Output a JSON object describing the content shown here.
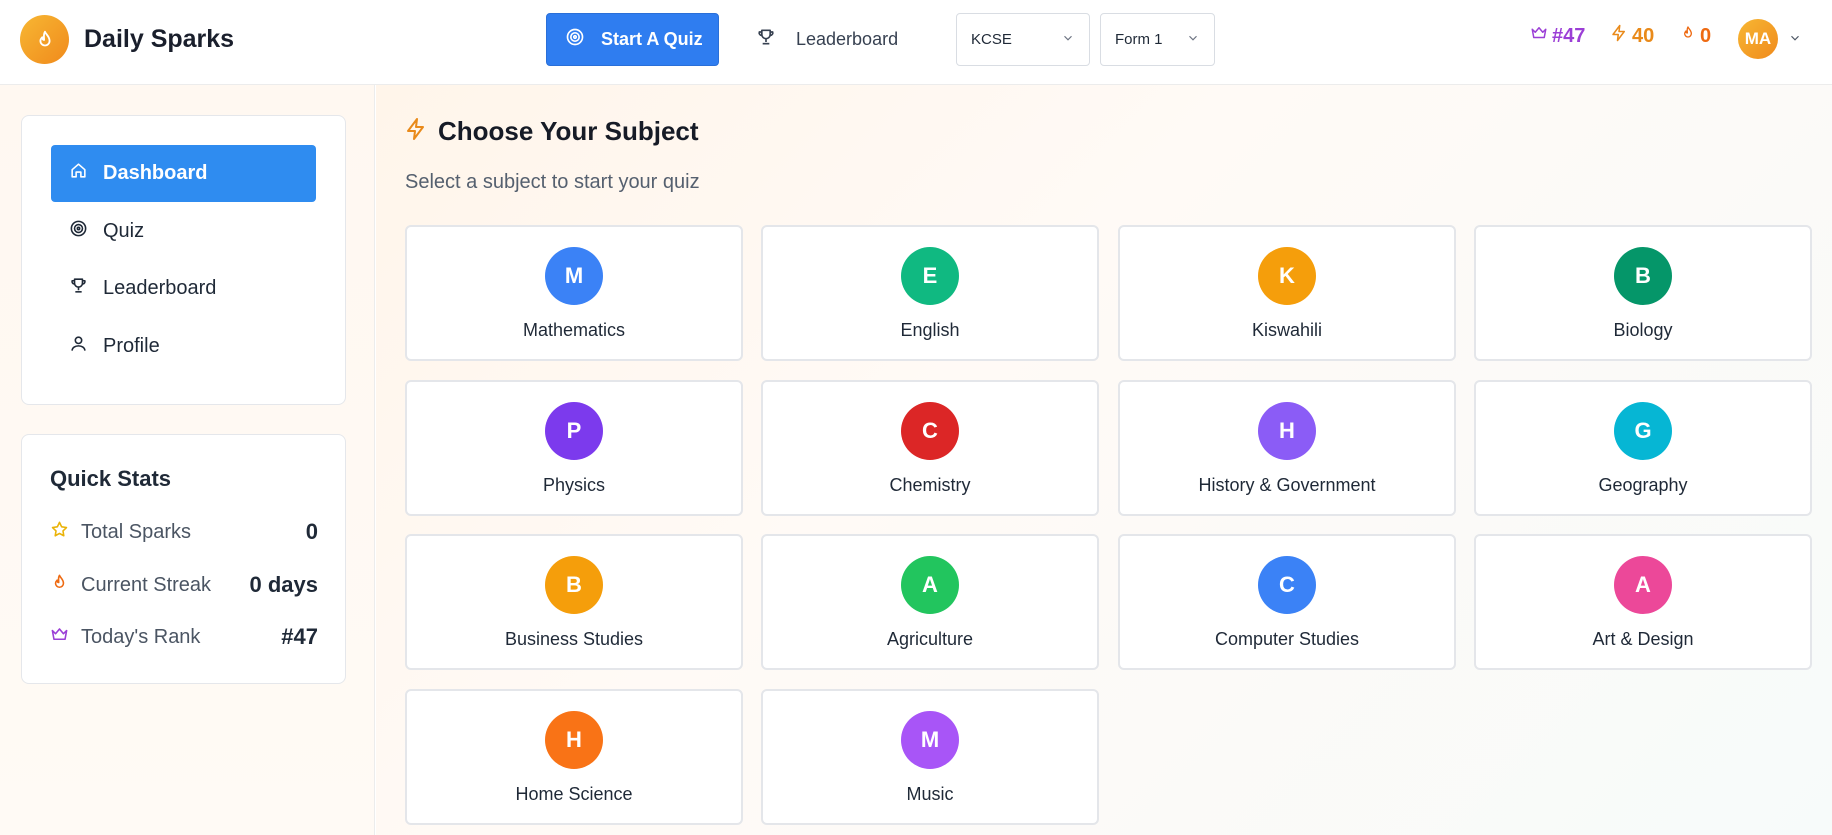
{
  "brand": {
    "name": "Daily Sparks"
  },
  "header": {
    "start_quiz_label": "Start A Quiz",
    "leaderboard_label": "Leaderboard",
    "exam_select": "KCSE",
    "form_select": "Form 1",
    "rank": "#47",
    "sparks": "40",
    "streak": "0",
    "avatar_initials": "MA"
  },
  "sidebar": {
    "nav": [
      {
        "label": "Dashboard",
        "icon": "home-icon",
        "active": true
      },
      {
        "label": "Quiz",
        "icon": "target-icon",
        "active": false
      },
      {
        "label": "Leaderboard",
        "icon": "trophy-icon",
        "active": false
      },
      {
        "label": "Profile",
        "icon": "user-icon",
        "active": false
      }
    ],
    "quick_stats": {
      "title": "Quick Stats",
      "items": [
        {
          "label": "Total Sparks",
          "value": "0",
          "icon": "star-icon"
        },
        {
          "label": "Current Streak",
          "value": "0 days",
          "icon": "flame-icon"
        },
        {
          "label": "Today's Rank",
          "value": "#47",
          "icon": "crown-icon"
        }
      ]
    }
  },
  "main": {
    "title": "Choose Your Subject",
    "subtitle": "Select a subject to start your quiz",
    "subjects": [
      {
        "letter": "M",
        "name": "Mathematics",
        "color": "#3b82f6"
      },
      {
        "letter": "E",
        "name": "English",
        "color": "#10b981"
      },
      {
        "letter": "K",
        "name": "Kiswahili",
        "color": "#f59e0b"
      },
      {
        "letter": "B",
        "name": "Biology",
        "color": "#059669"
      },
      {
        "letter": "P",
        "name": "Physics",
        "color": "#7c3aed"
      },
      {
        "letter": "C",
        "name": "Chemistry",
        "color": "#dc2626"
      },
      {
        "letter": "H",
        "name": "History & Government",
        "color": "#8b5cf6"
      },
      {
        "letter": "G",
        "name": "Geography",
        "color": "#06b6d4"
      },
      {
        "letter": "B",
        "name": "Business Studies",
        "color": "#f59e0b"
      },
      {
        "letter": "A",
        "name": "Agriculture",
        "color": "#22c55e"
      },
      {
        "letter": "C",
        "name": "Computer Studies",
        "color": "#3b82f6"
      },
      {
        "letter": "A",
        "name": "Art & Design",
        "color": "#ec4899"
      },
      {
        "letter": "H",
        "name": "Home Science",
        "color": "#f97316"
      },
      {
        "letter": "M",
        "name": "Music",
        "color": "#a855f7"
      }
    ]
  },
  "colors": {
    "primary": "#2f7df0",
    "accent_orange": "#f08a1c",
    "rank_purple": "#9b3fd6"
  }
}
